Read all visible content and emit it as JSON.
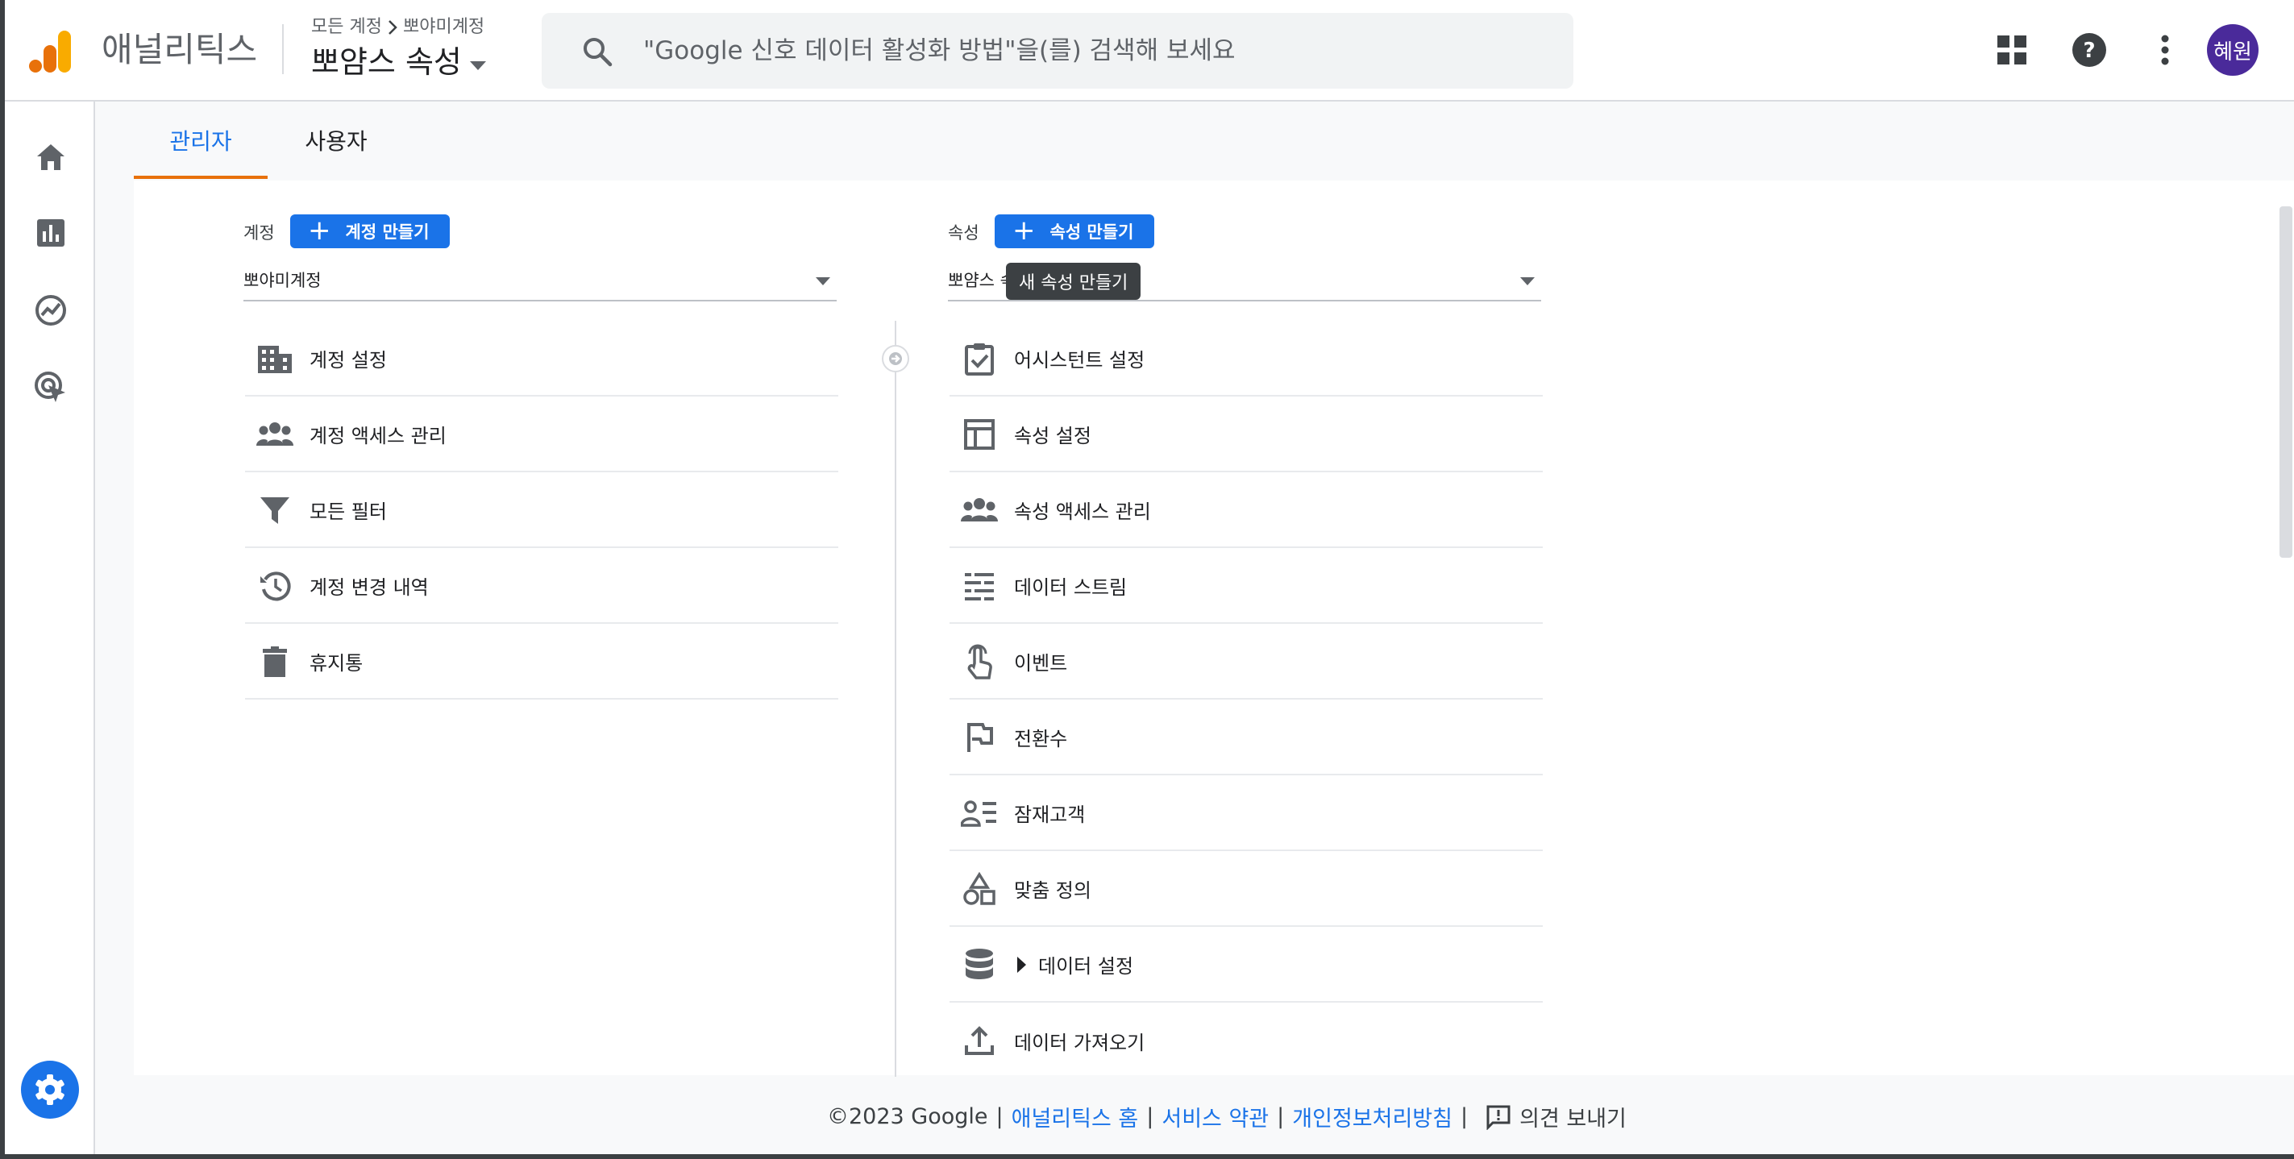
{
  "header": {
    "app_name": "애널리틱스",
    "breadcrumb": {
      "root": "모든 계정",
      "account": "뽀야미계정"
    },
    "property_title": "뽀얌스 속성",
    "search": {
      "placeholder": "\"Google 신호 데이터 활성화 방법\"을(를) 검색해 보세요"
    },
    "avatar_label": "혜원",
    "icons": [
      "apps-grid-icon",
      "help-icon",
      "more-vert-icon"
    ]
  },
  "left_nav": {
    "items": [
      "home-icon",
      "reports-icon",
      "explore-icon",
      "advertising-icon"
    ],
    "admin_fab": "settings-gear-icon"
  },
  "tabs": [
    {
      "label": "관리자",
      "active": true
    },
    {
      "label": "사용자",
      "active": false
    }
  ],
  "account_column": {
    "label": "계정",
    "create_button": "계정 만들기",
    "selected": "뽀야미계정",
    "items": [
      {
        "icon": "building-icon",
        "label": "계정 설정"
      },
      {
        "icon": "people-icon",
        "label": "계정 액세스 관리"
      },
      {
        "icon": "filter-icon",
        "label": "모든 필터"
      },
      {
        "icon": "history-icon",
        "label": "계정 변경 내역"
      },
      {
        "icon": "trash-icon",
        "label": "휴지통"
      }
    ]
  },
  "property_column": {
    "label": "속성",
    "create_button": "속성 만들기",
    "selected": "뽀얌스 속성",
    "tooltip": "새 속성 만들기",
    "items": [
      {
        "icon": "checklist-icon",
        "label": "어시스턴트 설정"
      },
      {
        "icon": "layout-icon",
        "label": "속성 설정"
      },
      {
        "icon": "people-icon",
        "label": "속성 액세스 관리"
      },
      {
        "icon": "data-stream-icon",
        "label": "데이터 스트림"
      },
      {
        "icon": "touch-icon",
        "label": "이벤트"
      },
      {
        "icon": "flag-icon",
        "label": "전환수"
      },
      {
        "icon": "audience-icon",
        "label": "잠재고객"
      },
      {
        "icon": "shapes-icon",
        "label": "맞춤 정의"
      },
      {
        "icon": "database-icon",
        "label": "데이터 설정",
        "expandable": true
      },
      {
        "icon": "upload-icon",
        "label": "데이터 가져오기"
      }
    ]
  },
  "footer": {
    "copyright": "©2023 Google",
    "links": [
      "애널리틱스 홈",
      "서비스 약관",
      "개인정보처리방침"
    ],
    "separator": "|",
    "feedback": "의견 보내기"
  },
  "colors": {
    "accent": "#1a73e8",
    "tab_underline": "#e8710a",
    "avatar": "#4a2a9a",
    "logo_orange": "#e8710a",
    "logo_yellow": "#f9ab00"
  }
}
